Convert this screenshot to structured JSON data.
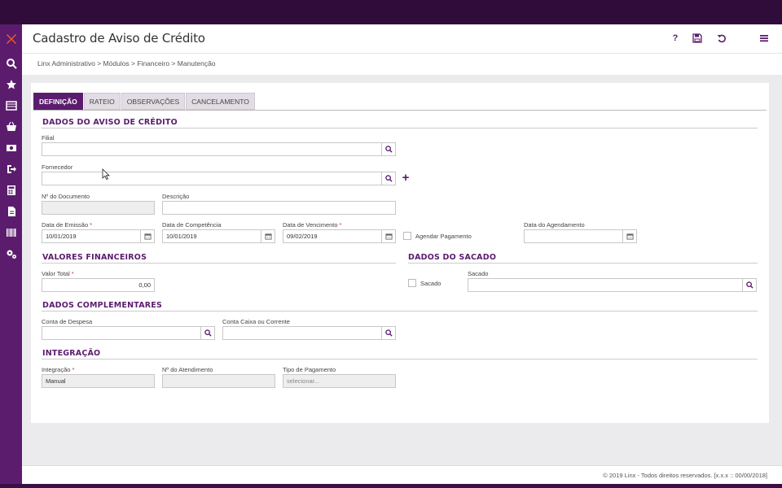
{
  "header": {
    "title": "Cadastro de Aviso de Crédito",
    "help_icon": "question-icon",
    "save_icon": "save-icon",
    "undo_icon": "undo-icon",
    "menu_icon": "hamburger-icon",
    "help_label": "?"
  },
  "breadcrumb": "Linx Administrativo  >  Módulos  >  Financeiro  >  Manutenção",
  "sidebar": {
    "items": [
      "logo-icon",
      "search-icon",
      "star-icon",
      "list-icon",
      "basket-icon",
      "money-icon",
      "exit-icon",
      "calculator-icon",
      "document-icon",
      "barcode-icon",
      "settings-icon"
    ]
  },
  "tabs": [
    {
      "label": "DEFINIÇÃO",
      "active": true
    },
    {
      "label": "RATEIO",
      "active": false
    },
    {
      "label": "OBSERVAÇÕES",
      "active": false
    },
    {
      "label": "CANCELAMENTO",
      "active": false
    }
  ],
  "sections": {
    "aviso": "DADOS DO AVISO DE CRÉDITO",
    "valores": "VALORES FINANCEIROS",
    "sacado": "DADOS DO SACADO",
    "complementares": "DADOS COMPLEMENTARES",
    "integracao": "INTEGRAÇÃO"
  },
  "fields": {
    "filial": {
      "label": "Filial",
      "value": ""
    },
    "fornecedor": {
      "label": "Fornecedor",
      "value": ""
    },
    "num_documento": {
      "label": "Nº do Documento",
      "value": ""
    },
    "descricao": {
      "label": "Descrição",
      "value": ""
    },
    "data_emissao": {
      "label": "Data de Emissão",
      "required": "*",
      "value": "10/01/2019"
    },
    "data_competencia": {
      "label": "Data de Competência",
      "value": "10/01/2019"
    },
    "data_vencimento": {
      "label": "Data de Vencimento",
      "required": "*",
      "value": "09/02/2019"
    },
    "agendar_pagamento": {
      "label": "Agendar Pagamento",
      "checked": false
    },
    "data_agendamento": {
      "label": "Data do Agendamento",
      "value": ""
    },
    "valor_total": {
      "label": "Valor Total",
      "required": "*",
      "value": "0,00"
    },
    "sacado_check": {
      "label": "Sacado",
      "checked": false
    },
    "sacado": {
      "label": "Sacado",
      "value": ""
    },
    "conta_despesa": {
      "label": "Conta de Despesa",
      "value": ""
    },
    "conta_caixa": {
      "label": "Conta Caixa ou Corrente",
      "value": ""
    },
    "integracao": {
      "label": "Integração",
      "required": "*",
      "value": "Manual"
    },
    "num_atendimento": {
      "label": "Nº do Atendimento",
      "value": ""
    },
    "tipo_pagamento": {
      "label": "Tipo de Pagamento",
      "placeholder": "selecionar..."
    }
  },
  "footer": "© 2019 Linx - Todos direitos reservados. [x.x.x :: 00/00/2018]",
  "colors": {
    "brand": "#5b1c6e",
    "top": "#2f0c3a"
  }
}
